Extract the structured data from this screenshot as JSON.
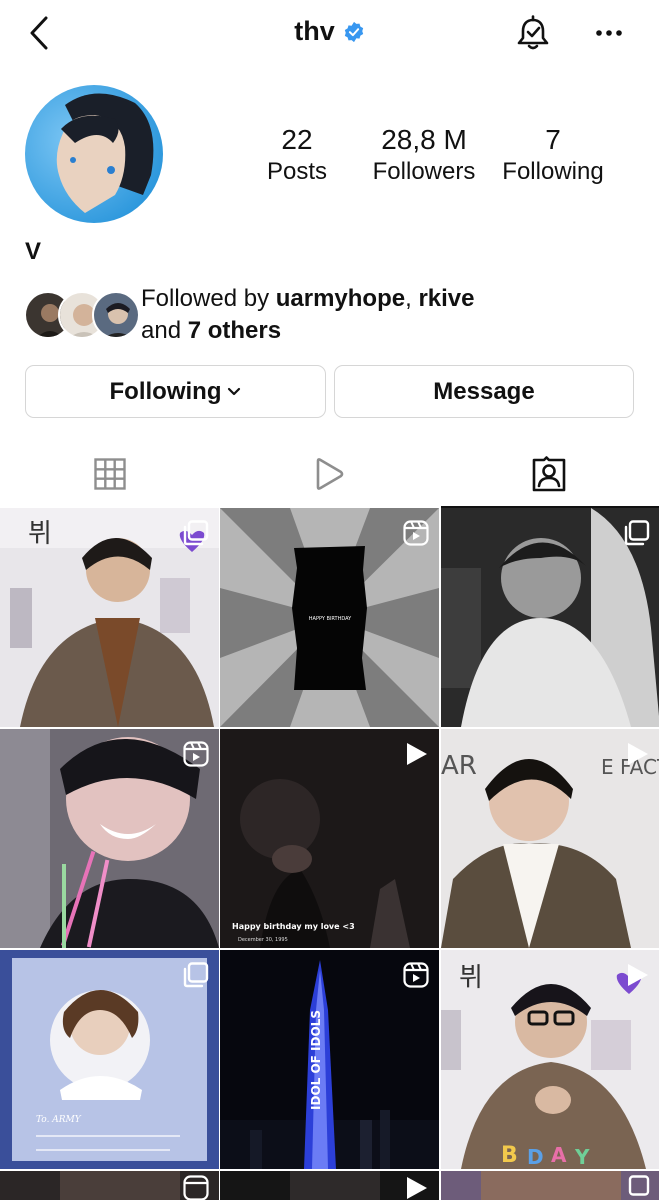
{
  "header": {
    "username": "thv"
  },
  "profile": {
    "stats": [
      {
        "value": "22",
        "label": "Posts"
      },
      {
        "value": "28,8 M",
        "label": "Followers"
      },
      {
        "value": "7",
        "label": "Following"
      }
    ],
    "display_name": "V",
    "followed_by": {
      "prefix": "Followed by ",
      "user1": "uarmyhope",
      "separator": ", ",
      "user2": "rkive",
      "line2_prefix": "and ",
      "others": "7 others"
    }
  },
  "actions": {
    "following_label": "Following",
    "message_label": "Message"
  },
  "tabs": [
    {
      "icon": "grid-icon"
    },
    {
      "icon": "reels-icon"
    },
    {
      "icon": "tagged-icon",
      "active": true
    }
  ],
  "grid": {
    "posts": [
      {
        "type": "carousel",
        "caption": ""
      },
      {
        "type": "reel",
        "caption": "HAPPY BIRTHDAY"
      },
      {
        "type": "carousel",
        "caption": ""
      },
      {
        "type": "reel",
        "caption": ""
      },
      {
        "type": "video",
        "caption": "Happy birthday my love <3",
        "subcaption": "December 30, 1995"
      },
      {
        "type": "video",
        "caption": ""
      },
      {
        "type": "carousel",
        "caption": "To. ARMY"
      },
      {
        "type": "reel",
        "caption": "IDOL OF IDOLS"
      },
      {
        "type": "video",
        "caption": ""
      }
    ]
  },
  "colors": {
    "verified": "#3897f0",
    "border": "#d6d6d6",
    "text": "#111111",
    "icon_gray": "#8e8e8e"
  }
}
